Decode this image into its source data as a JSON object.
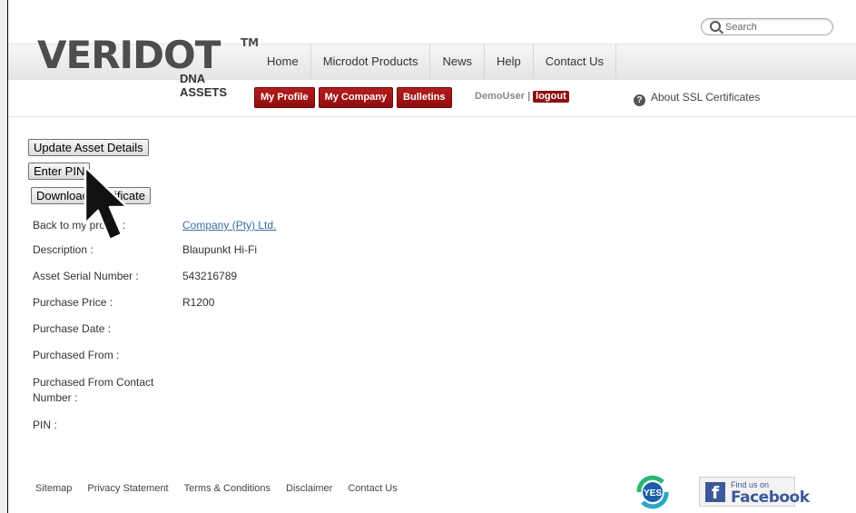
{
  "header": {
    "search_placeholder": "Search",
    "logo": {
      "text": "VERIDOT",
      "tm": "TM",
      "sub": "DNA ASSETS"
    },
    "nav": [
      "Home",
      "Microdot Products",
      "News",
      "Help",
      "Contact Us"
    ],
    "subnav": {
      "my_profile": "My Profile",
      "my_company": "My Company",
      "bulletins": "Bulletins"
    },
    "user": "DemoUser |",
    "logout": "logout",
    "ssl_link": "About SSL Certificates"
  },
  "actions": {
    "update": "Update Asset Details",
    "enter_pin": "Enter PIN",
    "download": "Download Certificate"
  },
  "details": [
    {
      "label": "Back to my profile :",
      "value": "Company (Pty) Ltd."
    },
    {
      "label": "Description :",
      "value": "Blaupunkt Hi-Fi"
    },
    {
      "label": "Asset Serial Number :",
      "value": "543216789"
    },
    {
      "label": "Purchase Price :",
      "value": "R1200"
    },
    {
      "label": "Purchase Date :",
      "value": ""
    },
    {
      "label": "Purchased From :",
      "value": ""
    },
    {
      "label": "Purchased From Contact Number :",
      "value": ""
    },
    {
      "label": "PIN :",
      "value": ""
    }
  ],
  "footer": {
    "links": [
      "Sitemap",
      "Privacy Statement",
      "Terms & Conditions",
      "Disclaimer",
      "Contact Us"
    ],
    "yes_badge": "YES",
    "facebook_small": "Find us on",
    "facebook_big": "Facebook"
  },
  "colors": {
    "brand_red": "#8e0e0e",
    "logo_red": "#cc1f1f",
    "link_blue": "#3b6ea5",
    "facebook": "#3b5998"
  }
}
